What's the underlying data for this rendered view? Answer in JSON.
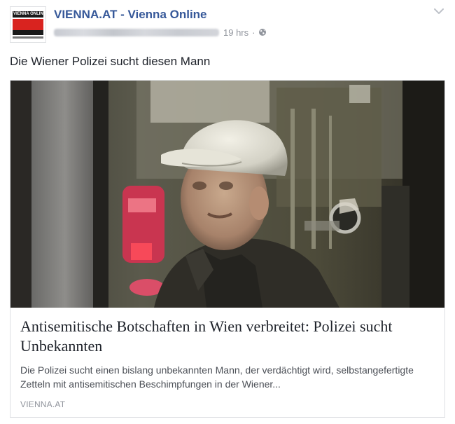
{
  "page": {
    "name": "VIENNA.AT - Vienna Online",
    "logo_text": "VIENNA ONLINE"
  },
  "meta": {
    "time": "19 hrs",
    "separator": "·"
  },
  "post": {
    "message": "Die Wiener Polizei sucht diesen Mann"
  },
  "link_card": {
    "title": "Antisemitische Botschaften in Wien verbreitet: Polizei sucht Unbekannten",
    "description": "Die Polizei sucht einen bislang unbekannten Mann, der verdächtigt wird, selbstangefertigte Zetteln mit antisemitischen Beschimpfungen in der Wiener...",
    "source": "VIENNA.AT"
  },
  "icons": {
    "privacy": "globe-icon",
    "menu": "chevron-down-icon"
  },
  "colors": {
    "page_name": "#365899",
    "meta_text": "#90949c",
    "logo_red": "#d9231f"
  }
}
